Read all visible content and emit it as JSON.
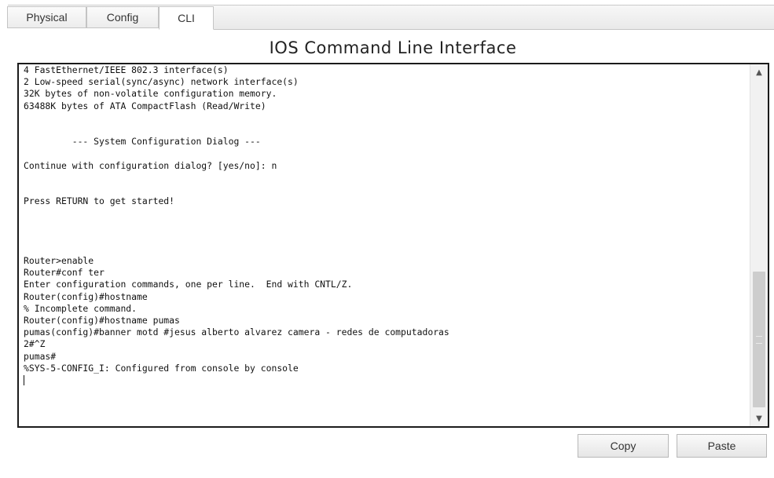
{
  "tabs": [
    {
      "label": "Physical",
      "active": false
    },
    {
      "label": "Config",
      "active": false
    },
    {
      "label": "CLI",
      "active": true
    }
  ],
  "title": "IOS Command Line Interface",
  "console": {
    "lines": [
      "4 FastEthernet/IEEE 802.3 interface(s)",
      "2 Low-speed serial(sync/async) network interface(s)",
      "32K bytes of non-volatile configuration memory.",
      "63488K bytes of ATA CompactFlash (Read/Write)",
      "",
      "",
      "         --- System Configuration Dialog ---",
      "",
      "Continue with configuration dialog? [yes/no]: n",
      "",
      "",
      "Press RETURN to get started!",
      "",
      "",
      "",
      "",
      "Router>enable",
      "Router#conf ter",
      "Enter configuration commands, one per line.  End with CNTL/Z.",
      "Router(config)#hostname",
      "% Incomplete command.",
      "Router(config)#hostname pumas",
      "pumas(config)#banner motd #jesus alberto alvarez camera - redes de computadoras",
      "2#^Z",
      "pumas#",
      "%SYS-5-CONFIG_I: Configured from console by console",
      ""
    ]
  },
  "scrollbar": {
    "up_icon": "▲",
    "down_icon": "▼"
  },
  "buttons": {
    "copy_label": "Copy",
    "paste_label": "Paste"
  }
}
